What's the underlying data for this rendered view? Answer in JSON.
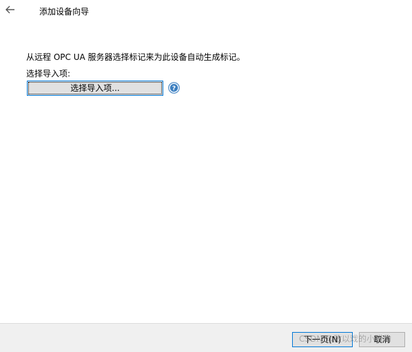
{
  "window": {
    "title": "添加设备向导"
  },
  "main": {
    "description": "从远程 OPC UA 服务器选择标记来为此设备自动生成标记。",
    "import_label": "选择导入项:",
    "select_button_label": "选择导入项...",
    "help_icon": "help-circle-icon"
  },
  "footer": {
    "next_label": "下一页(N)",
    "cancel_label": "取消"
  },
  "watermark": {
    "text": "CSDN @致以戏的小猎豹"
  },
  "colors": {
    "accent": "#0078d7",
    "help_icon": "#3c7fc0",
    "footer_bg": "#f0f0f0"
  }
}
